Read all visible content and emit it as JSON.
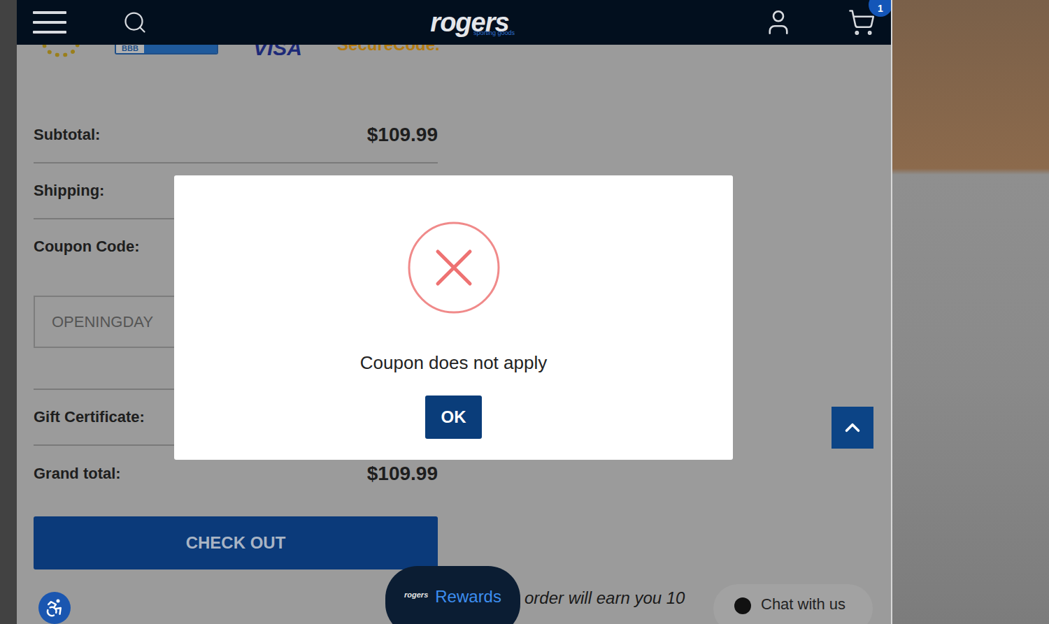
{
  "header": {
    "logo": "rogers",
    "logo_tagline": "sporting goods",
    "cart_count": "1"
  },
  "payment_badges": [
    "BBB",
    "VISA",
    "SecureCode."
  ],
  "summary": {
    "rows": [
      {
        "kind": "amount",
        "label": "Subtotal:",
        "value": "$109.99"
      },
      {
        "kind": "amount",
        "label": "Shipping:",
        "value": ""
      },
      {
        "kind": "coupon",
        "label": "Coupon Code:",
        "value": "OPENINGDAY"
      },
      {
        "kind": "amount",
        "label": "Gift Certificate:",
        "value": ""
      },
      {
        "kind": "total",
        "label": "Grand total:",
        "value": "$109.99"
      }
    ]
  },
  "checkout_button": "CHECK OUT",
  "modal": {
    "message": "Coupon does not apply",
    "button": "OK"
  },
  "rewards": {
    "logo": "rogers",
    "label": "Rewards",
    "note": "order will earn you 10"
  },
  "chat": {
    "label": "Chat with us"
  }
}
